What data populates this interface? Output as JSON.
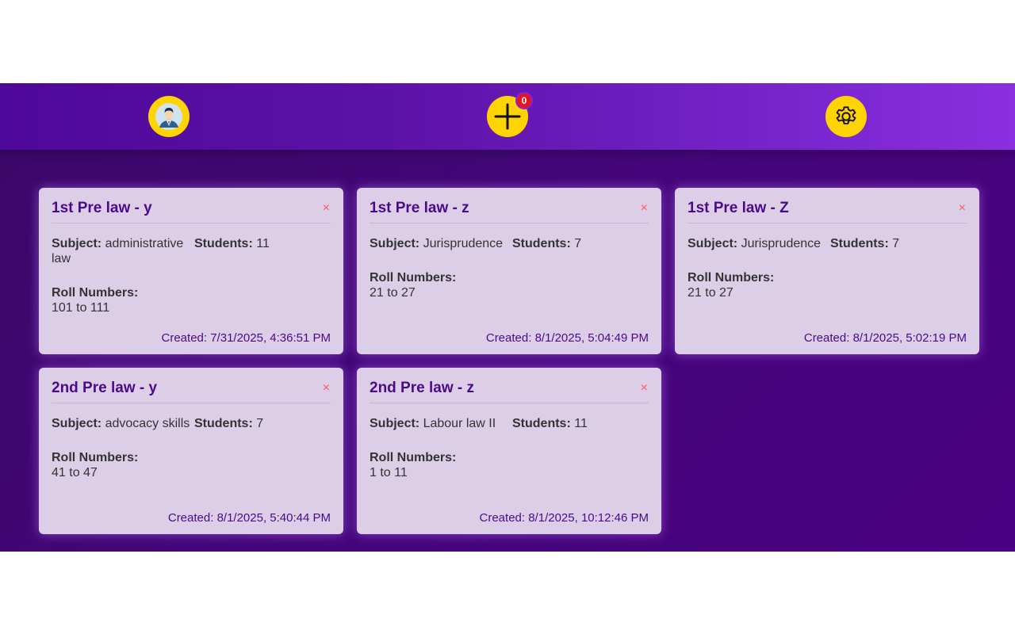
{
  "nav": {
    "notification_count": "0"
  },
  "labels": {
    "subject": "Subject:",
    "students": "Students:",
    "roll_numbers": "Roll Numbers:",
    "created_prefix": "Created: ",
    "close": "×"
  },
  "cards": [
    {
      "title": "1st Pre law - y",
      "subject": "administrative law",
      "students": "11",
      "roll": "101 to 111",
      "created": "7/31/2025, 4:36:51 PM"
    },
    {
      "title": "1st Pre law - z",
      "subject": "Jurisprudence",
      "students": "7",
      "roll": "21 to 27",
      "created": "8/1/2025, 5:04:49 PM"
    },
    {
      "title": "1st Pre law - Z",
      "subject": "Jurisprudence",
      "students": "7",
      "roll": "21 to 27",
      "created": "8/1/2025, 5:02:19 PM"
    },
    {
      "title": "2nd Pre law - y",
      "subject": "advocacy skills",
      "students": "7",
      "roll": "41 to 47",
      "created": "8/1/2025, 5:40:44 PM"
    },
    {
      "title": "2nd Pre law - z",
      "subject": "Labour law II",
      "students": "11",
      "roll": "1 to 11",
      "created": "8/1/2025, 10:12:46 PM"
    }
  ],
  "colors": {
    "accent_yellow": "#ffd400",
    "title_purple": "#4b0a8a",
    "close_red": "#ff5a5a",
    "badge_red": "#e8141c"
  }
}
